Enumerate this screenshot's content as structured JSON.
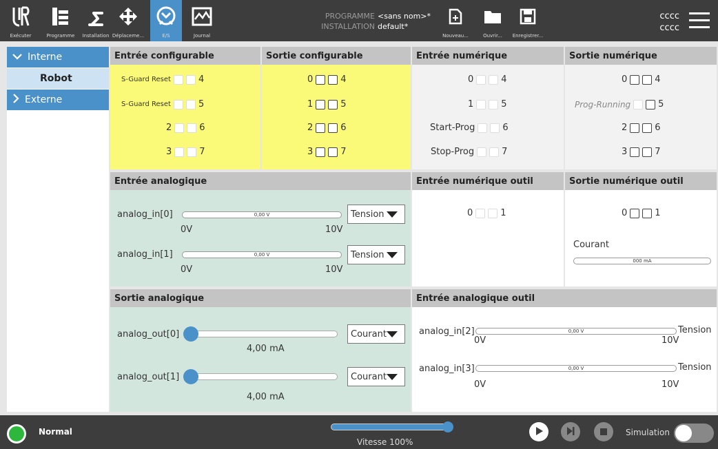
{
  "topbar": {
    "nav": [
      {
        "label": "Exécuter",
        "icon": "ur-logo-icon"
      },
      {
        "label": "Programme",
        "icon": "program-tree-icon"
      },
      {
        "label": "Installation",
        "icon": "robot-arm-icon"
      },
      {
        "label": "Déplaceme...",
        "icon": "move-arrows-icon"
      },
      {
        "label": "E/S",
        "icon": "io-icon",
        "active": true
      },
      {
        "label": "Journal",
        "icon": "log-chart-icon"
      }
    ],
    "program_key": "PROGRAMME",
    "program_value": "<sans nom>*",
    "installation_key": "INSTALLATION",
    "installation_value": "default*",
    "actions": [
      {
        "label": "Nouveau...",
        "icon": "new-file-icon"
      },
      {
        "label": "Ouvrir...",
        "icon": "folder-icon"
      },
      {
        "label": "Enregistrer...",
        "icon": "save-icon"
      }
    ],
    "user_line1": "cccc",
    "user_line2": "cccc"
  },
  "sidebar": {
    "items": [
      {
        "label": "Interne"
      },
      {
        "label": "Robot"
      },
      {
        "label": "Externe"
      }
    ]
  },
  "panels": {
    "config_in": {
      "title": "Entrée configurable",
      "rows": [
        {
          "left": "S-Guard Reset",
          "right": "4"
        },
        {
          "left": "S-Guard Reset",
          "right": "5"
        },
        {
          "left": "2",
          "right": "6"
        },
        {
          "left": "3",
          "right": "7"
        }
      ]
    },
    "config_out": {
      "title": "Sortie configurable",
      "rows": [
        {
          "left": "0",
          "right": "4"
        },
        {
          "left": "1",
          "right": "5"
        },
        {
          "left": "2",
          "right": "6"
        },
        {
          "left": "3",
          "right": "7"
        }
      ]
    },
    "dig_in": {
      "title": "Entrée numérique",
      "rows": [
        {
          "left": "0",
          "right": "4"
        },
        {
          "left": "1",
          "right": "5"
        },
        {
          "left": "Start-Prog",
          "right": "6"
        },
        {
          "left": "Stop-Prog",
          "right": "7"
        }
      ]
    },
    "dig_out": {
      "title": "Sortie numérique",
      "rows": [
        {
          "left": "0",
          "right": "4"
        },
        {
          "left": "Prog-Running",
          "right": "5"
        },
        {
          "left": "2",
          "right": "6"
        },
        {
          "left": "3",
          "right": "7"
        }
      ]
    },
    "analog_in": {
      "title": "Entrée analogique",
      "rows": [
        {
          "name": "analog_in[0]",
          "value": "0,00 V",
          "min": "0V",
          "max": "10V",
          "mode": "Tension"
        },
        {
          "name": "analog_in[1]",
          "value": "0,00 V",
          "min": "0V",
          "max": "10V",
          "mode": "Tension"
        }
      ]
    },
    "tool_dig_in": {
      "title": "Entrée numérique outil",
      "left": "0",
      "right": "1"
    },
    "tool_dig_out": {
      "title": "Sortie numérique outil",
      "left": "0",
      "right": "1",
      "current_label": "Courant",
      "current_value": "000 mA"
    },
    "analog_out": {
      "title": "Sortie analogique",
      "rows": [
        {
          "name": "analog_out[0]",
          "value": "4,00 mA",
          "mode": "Courant",
          "level": 0
        },
        {
          "name": "analog_out[1]",
          "value": "4,00 mA",
          "mode": "Courant",
          "level": 0
        }
      ]
    },
    "tool_analog_in": {
      "title": "Entrée analogique outil",
      "rows": [
        {
          "name": "analog_in[2]",
          "value": "0,00 V",
          "min": "0V",
          "max": "10V",
          "mode": "Tension"
        },
        {
          "name": "analog_in[3]",
          "value": "0,00 V",
          "min": "0V",
          "max": "10V",
          "mode": "Tension"
        }
      ]
    }
  },
  "footer": {
    "status": "Normal",
    "speed": "Vitesse 100%",
    "speed_level": 100,
    "simulation": "Simulation",
    "colors": {
      "status": "#2db83d",
      "accent": "#4a90c9"
    }
  }
}
